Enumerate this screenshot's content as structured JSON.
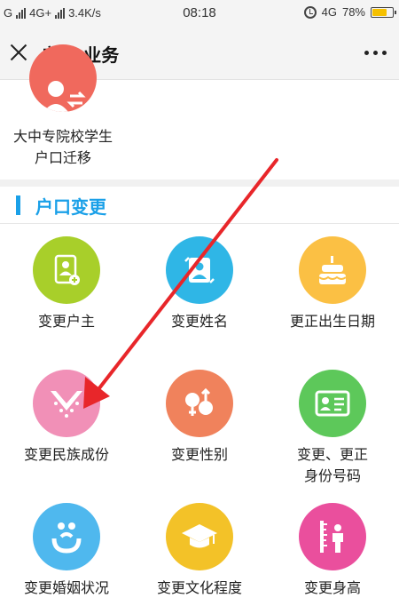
{
  "status_bar": {
    "left_text_1": "G",
    "left_text_2": "4G+",
    "speed": "3.4K/s",
    "time": "08:18",
    "network": "4G",
    "battery": "78%",
    "battery_level": 0.78
  },
  "nav": {
    "title": "户籍-业务"
  },
  "partial_item": {
    "line1": "大中专院校学生",
    "line2": "户口迁移",
    "color": "#f0695d"
  },
  "section": {
    "title": "户口变更",
    "accent": "#1aa0e8"
  },
  "items": [
    {
      "line1": "变更户主",
      "line2": "",
      "color": "#a8cf2a",
      "icon": "document-person-icon"
    },
    {
      "line1": "变更姓名",
      "line2": "",
      "color": "#2fb6e6",
      "icon": "id-card-icon"
    },
    {
      "line1": "更正出生日期",
      "line2": "",
      "color": "#fbc044",
      "icon": "cake-icon"
    },
    {
      "line1": "变更民族成份",
      "line2": "",
      "color": "#f190b7",
      "icon": "ethnic-collar-icon"
    },
    {
      "line1": "变更性别",
      "line2": "",
      "color": "#f0825c",
      "icon": "gender-icon"
    },
    {
      "line1": "变更、更正",
      "line2": "身份号码",
      "color": "#5dc85a",
      "icon": "id-number-icon"
    },
    {
      "line1": "变更婚姻状况",
      "line2": "",
      "color": "#4fb8ee",
      "icon": "marriage-icon"
    },
    {
      "line1": "变更文化程度",
      "line2": "",
      "color": "#f3c228",
      "icon": "graduation-cap-icon"
    },
    {
      "line1": "变更身高",
      "line2": "",
      "color": "#ea4f9d",
      "icon": "height-icon"
    }
  ]
}
